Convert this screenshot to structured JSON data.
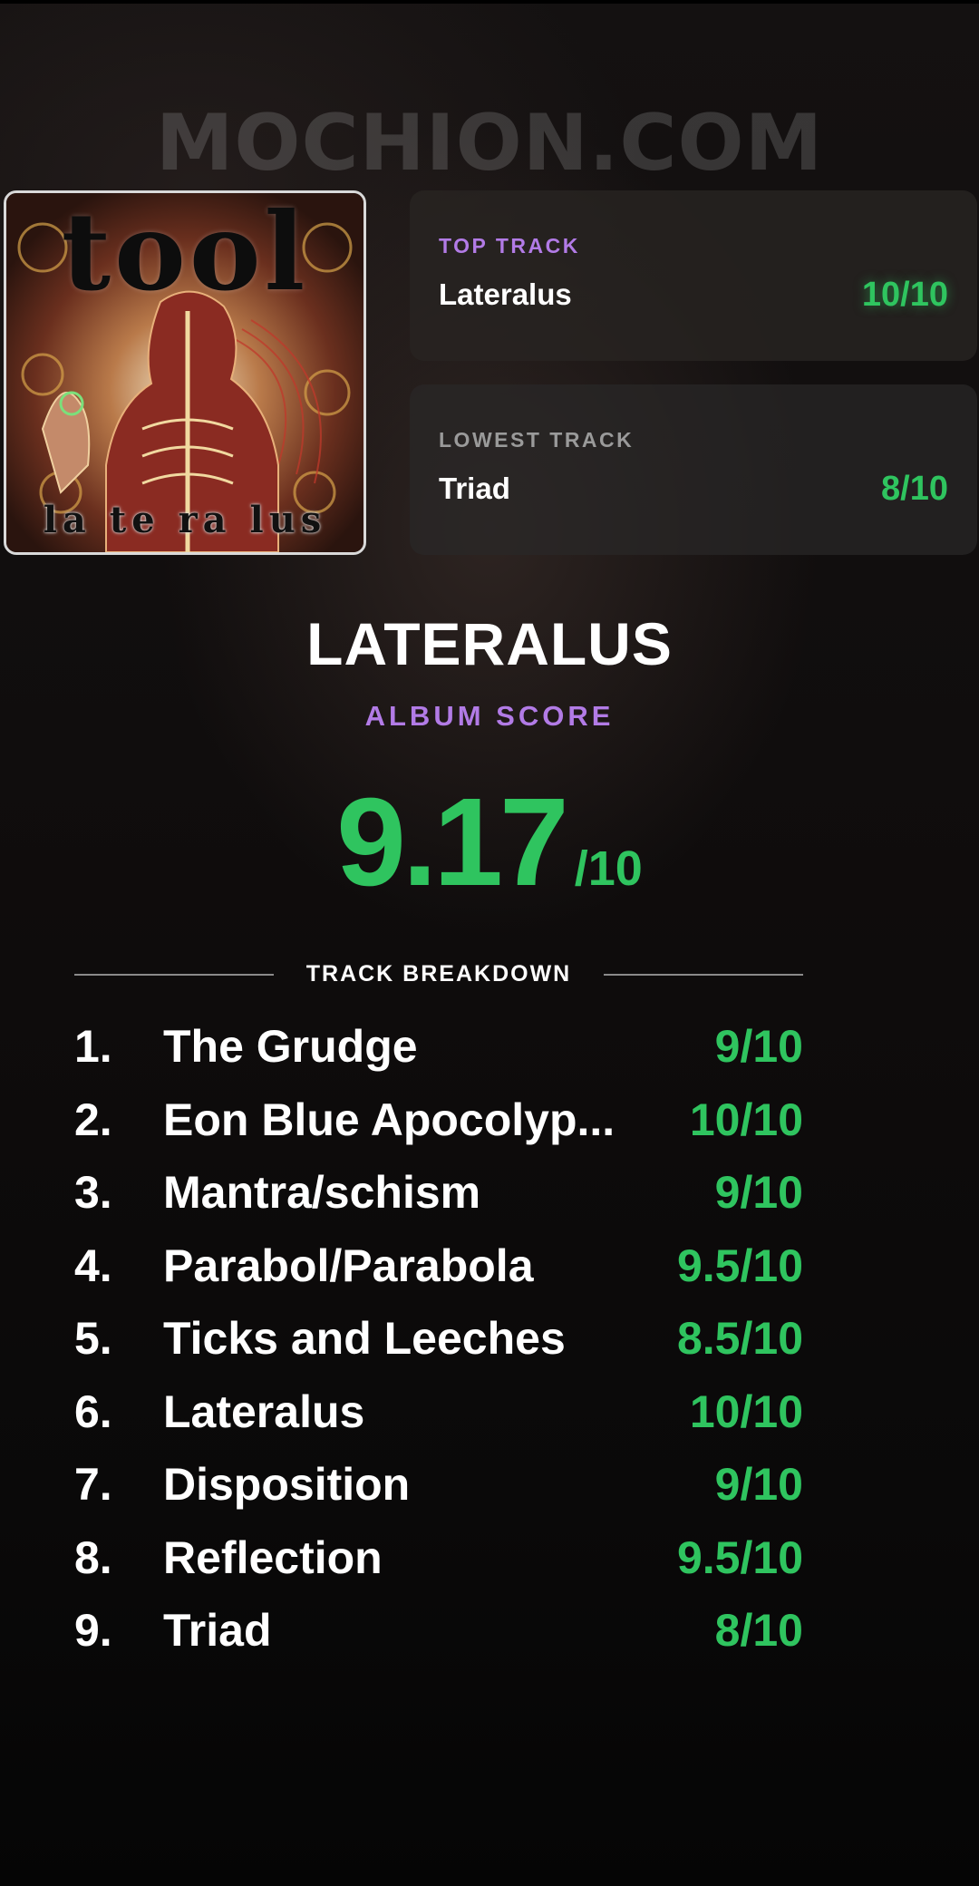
{
  "watermark": "MOCHION.COM",
  "cover": {
    "band_lettering": "tool",
    "album_lettering": "la te ra lus"
  },
  "top_track": {
    "label": "TOP TRACK",
    "name": "Lateralus",
    "score": "10/10"
  },
  "lowest_track": {
    "label": "LOWEST TRACK",
    "name": "Triad",
    "score": "8/10"
  },
  "album": {
    "title": "LATERALUS",
    "score_label": "ALBUM SCORE",
    "score": "9.17",
    "score_denominator": "/10"
  },
  "breakdown": {
    "heading": "TRACK BREAKDOWN",
    "tracks": [
      {
        "num": "1.",
        "name": "The Grudge",
        "score": "9/10"
      },
      {
        "num": "2.",
        "name": "Eon Blue Apocolyp...",
        "score": "10/10"
      },
      {
        "num": "3.",
        "name": "Mantra/schism",
        "score": "9/10"
      },
      {
        "num": "4.",
        "name": "Parabol/Parabola",
        "score": "9.5/10"
      },
      {
        "num": "5.",
        "name": "Ticks and Leeches",
        "score": "8.5/10"
      },
      {
        "num": "6.",
        "name": "Lateralus",
        "score": "10/10"
      },
      {
        "num": "7.",
        "name": "Disposition",
        "score": "9/10"
      },
      {
        "num": "8.",
        "name": "Reflection",
        "score": "9.5/10"
      },
      {
        "num": "9.",
        "name": "Triad",
        "score": "8/10"
      }
    ]
  },
  "colors": {
    "accent_purple": "#b27be6",
    "score_green": "#2fc45f",
    "background": "#0b0909"
  }
}
